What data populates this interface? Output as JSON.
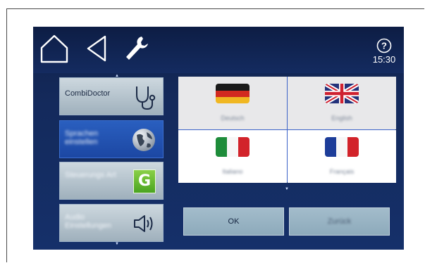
{
  "header": {
    "home_icon": "home-icon",
    "back_icon": "back-triangle-icon",
    "tools_icon": "wrench-icon",
    "help_icon": "help-question-icon",
    "time": "15:30"
  },
  "sidebar": {
    "items": [
      {
        "label": "CombiDoctor",
        "icon": "stethoscope-icon"
      },
      {
        "label": "Sprachen einstellen",
        "icon": "globe-icon"
      },
      {
        "label": "Steuerungs Art",
        "icon": "letter-g-icon",
        "badge": "G"
      },
      {
        "label": "Audio Einstellungen",
        "icon": "speaker-icon"
      }
    ],
    "scroll_up": "▲",
    "scroll_down": "▼"
  },
  "languages": {
    "items": [
      {
        "label": "Deutsch",
        "flag": "germany-flag-icon"
      },
      {
        "label": "English",
        "flag": "uk-flag-icon"
      },
      {
        "label": "Italiano",
        "flag": "italy-flag-icon"
      },
      {
        "label": "Français",
        "flag": "france-flag-icon"
      }
    ],
    "scroll_down": "▼"
  },
  "buttons": {
    "ok": "OK",
    "back": "Zurück"
  }
}
